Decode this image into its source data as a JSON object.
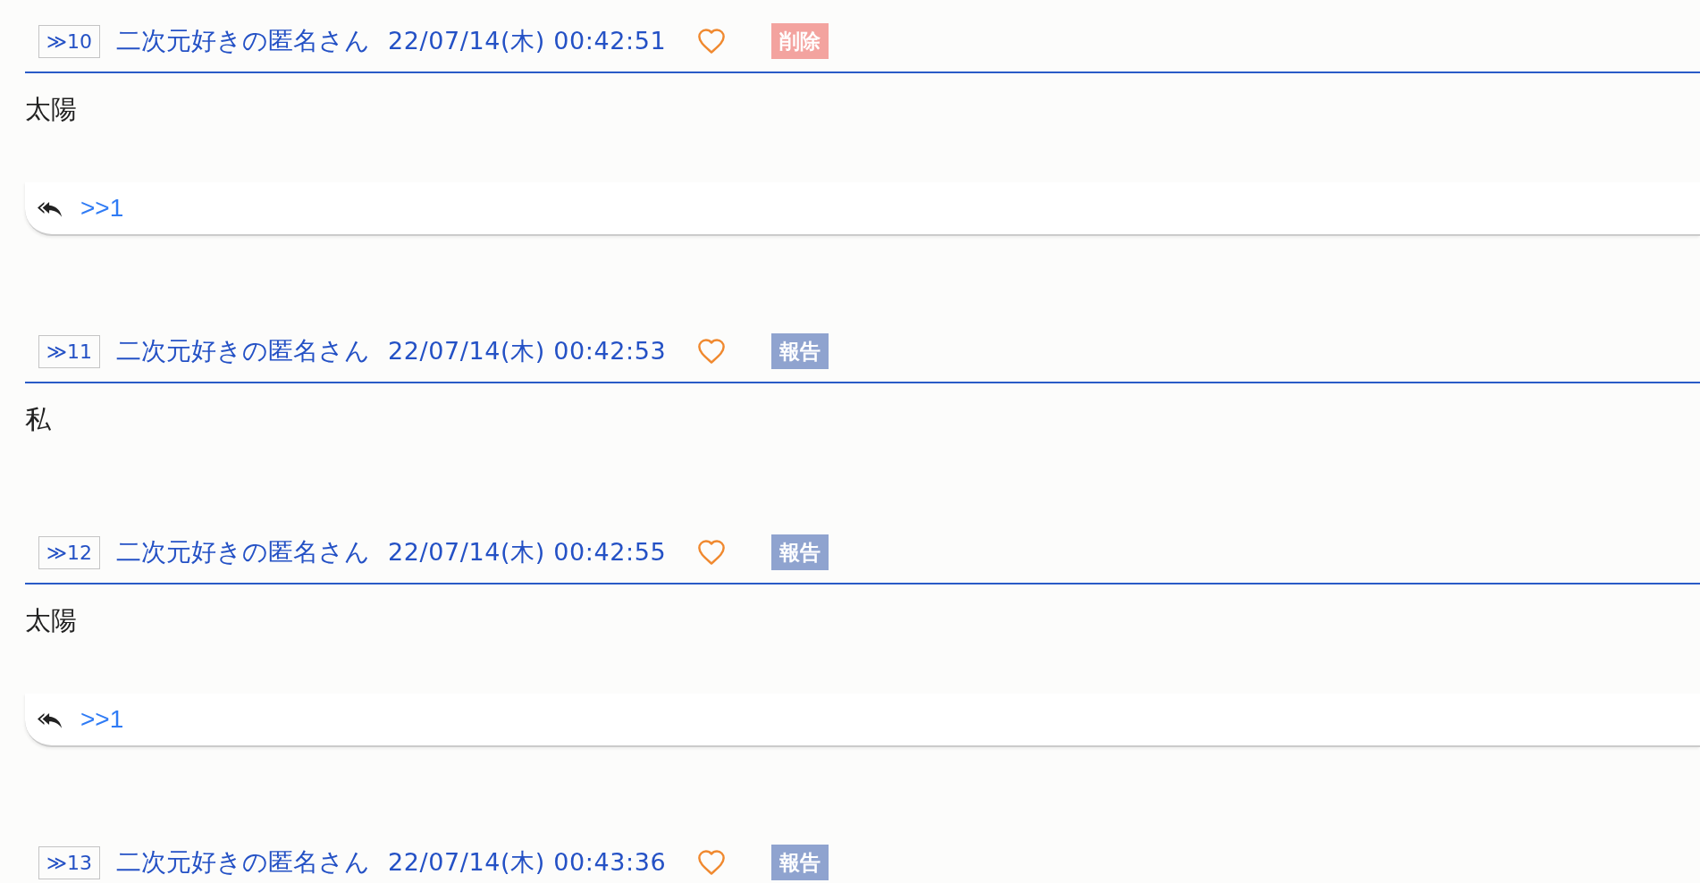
{
  "posts": [
    {
      "number": "≫10",
      "name": "二次元好きの匿名さん",
      "timestamp": "22/07/14(木) 00:42:51",
      "action": {
        "label": "削除",
        "kind": "delete"
      },
      "body": "太陽",
      "replies": [
        ">>1"
      ]
    },
    {
      "number": "≫11",
      "name": "二次元好きの匿名さん",
      "timestamp": "22/07/14(木) 00:42:53",
      "action": {
        "label": "報告",
        "kind": "report"
      },
      "body": "私"
    },
    {
      "number": "≫12",
      "name": "二次元好きの匿名さん",
      "timestamp": "22/07/14(木) 00:42:55",
      "action": {
        "label": "報告",
        "kind": "report"
      },
      "body": "太陽",
      "replies": [
        ">>1"
      ]
    },
    {
      "number": "≫13",
      "name": "二次元好きの匿名さん",
      "timestamp": "22/07/14(木) 00:43:36",
      "action": {
        "label": "報告",
        "kind": "report"
      }
    }
  ]
}
